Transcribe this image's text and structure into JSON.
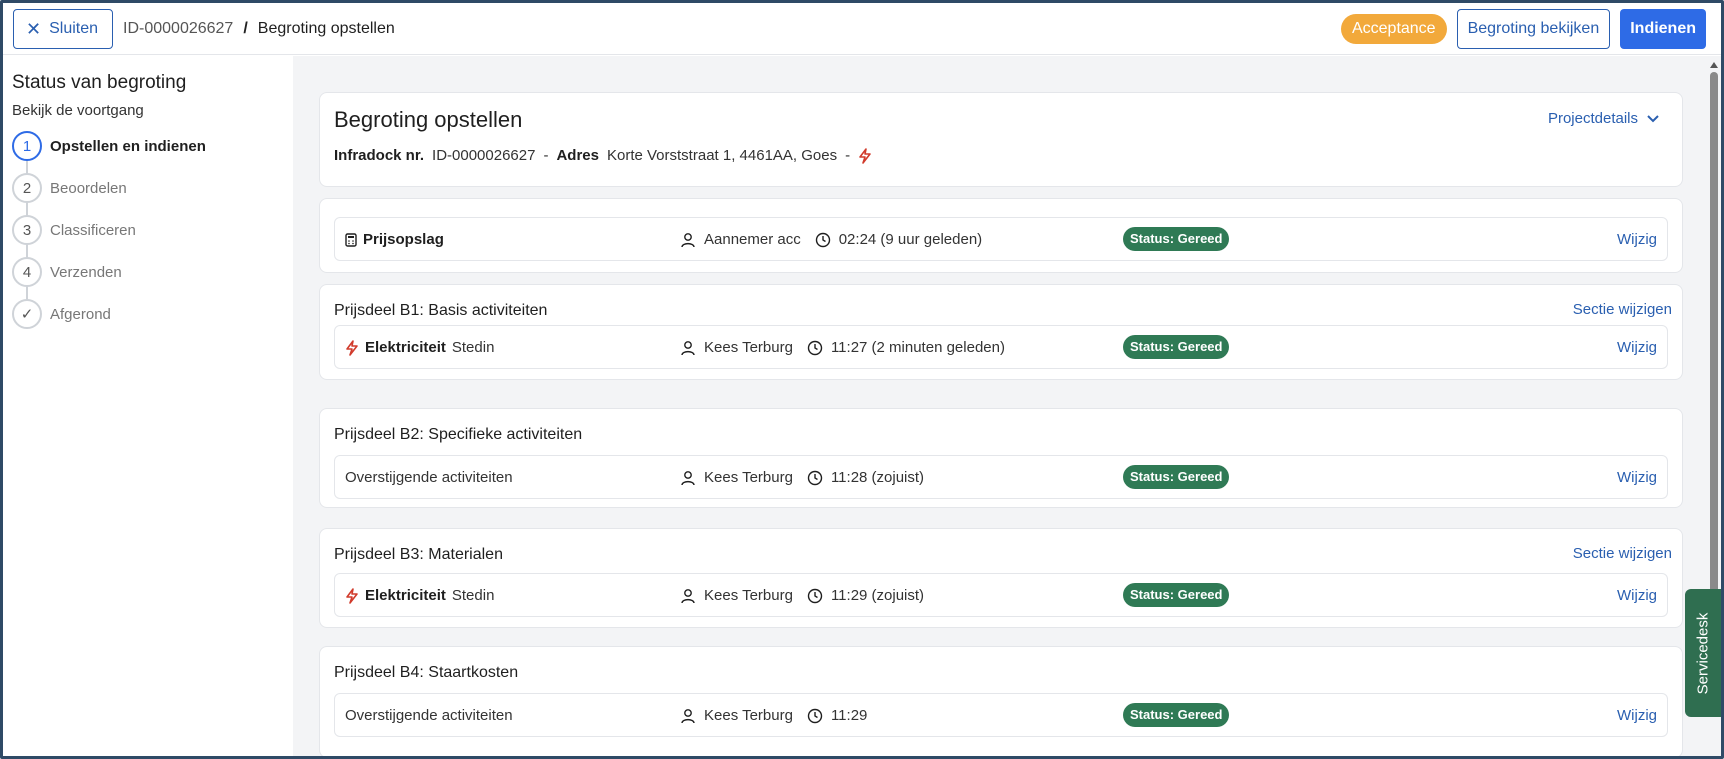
{
  "header": {
    "close_label": "Sluiten",
    "id": "ID-0000026627",
    "separator": "/",
    "current_page": "Begroting opstellen",
    "status_pill": "Acceptance",
    "view_label": "Begroting bekijken",
    "submit_label": "Indienen"
  },
  "sidebar": {
    "title": "Status van begroting",
    "subtitle": "Bekijk de voortgang",
    "steps": [
      {
        "number": "1",
        "label": "Opstellen en indienen",
        "active": true
      },
      {
        "number": "2",
        "label": "Beoordelen"
      },
      {
        "number": "3",
        "label": "Classificeren"
      },
      {
        "number": "4",
        "label": "Verzenden"
      },
      {
        "number": "✓",
        "label": "Afgerond"
      }
    ]
  },
  "main": {
    "title": "Begroting opstellen",
    "project_link": "Projectdetails",
    "infradock_label": "Infradock nr.",
    "infradock_value": "ID-0000026627",
    "dash": "-",
    "address_label": "Adres",
    "address_value": "Korte Vorststraat 1, 4461AA, Goes",
    "prijsopslag": {
      "label": "Prijsopslag",
      "user": "Aannemer acc",
      "time": "02:24 (9 uur geleden)",
      "status": "Status: Gereed",
      "action": "Wijzig"
    },
    "sections": [
      {
        "title": "Prijsdeel B1: Basis activiteiten",
        "link": "Sectie wijzigen",
        "row": {
          "bold": "Elektriciteit",
          "normal": "Stedin",
          "user": "Kees Terburg",
          "time": "11:27 (2 minuten geleden)",
          "status": "Status: Gereed",
          "action": "Wijzig"
        }
      },
      {
        "title": "Prijsdeel B2: Specifieke activiteiten",
        "link": "",
        "row": {
          "bold": "",
          "normal": "Overstijgende activiteiten",
          "user": "Kees Terburg",
          "time": "11:28 (zojuist)",
          "status": "Status: Gereed",
          "action": "Wijzig"
        }
      },
      {
        "title": "Prijsdeel B3: Materialen",
        "link": "Sectie wijzigen",
        "row": {
          "bold": "Elektriciteit",
          "normal": "Stedin",
          "user": "Kees Terburg",
          "time": "11:29 (zojuist)",
          "status": "Status: Gereed",
          "action": "Wijzig"
        }
      },
      {
        "title": "Prijsdeel B4: Staartkosten",
        "link": "",
        "row": {
          "bold": "",
          "normal": "Overstijgende activiteiten",
          "user": "Kees Terburg",
          "time": "11:29",
          "status": "Status: Gereed",
          "action": "Wijzig"
        }
      }
    ]
  },
  "servicedesk_label": "Servicedesk",
  "colors": {
    "primary": "#2e6be6",
    "link": "#2a5fb0",
    "acceptance": "#f2a93b",
    "status_green": "#2f7a55",
    "bolt": "#d13b2c"
  }
}
